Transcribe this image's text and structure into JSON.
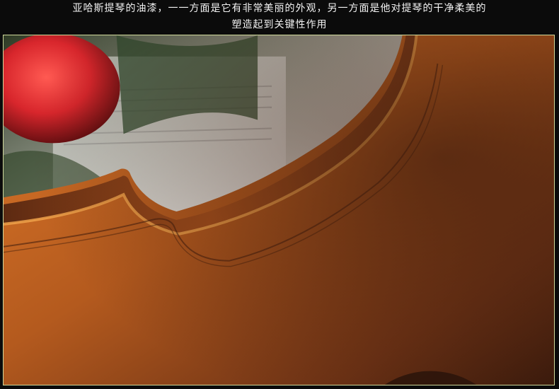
{
  "caption": {
    "line1": "亚哈斯提琴的油漆，一一方面是它有非常美丽的外观，另一方面是他对提琴的干净柔美的",
    "line2": "塑造起到关键性作用"
  },
  "colors": {
    "background": "#0b0b0b",
    "caption_text": "#f2f2f2",
    "frame_border": "#cfd89a",
    "varnish_orange": "#c8641e",
    "varnish_dark": "#4a2410",
    "rose_red": "#d8262c"
  }
}
